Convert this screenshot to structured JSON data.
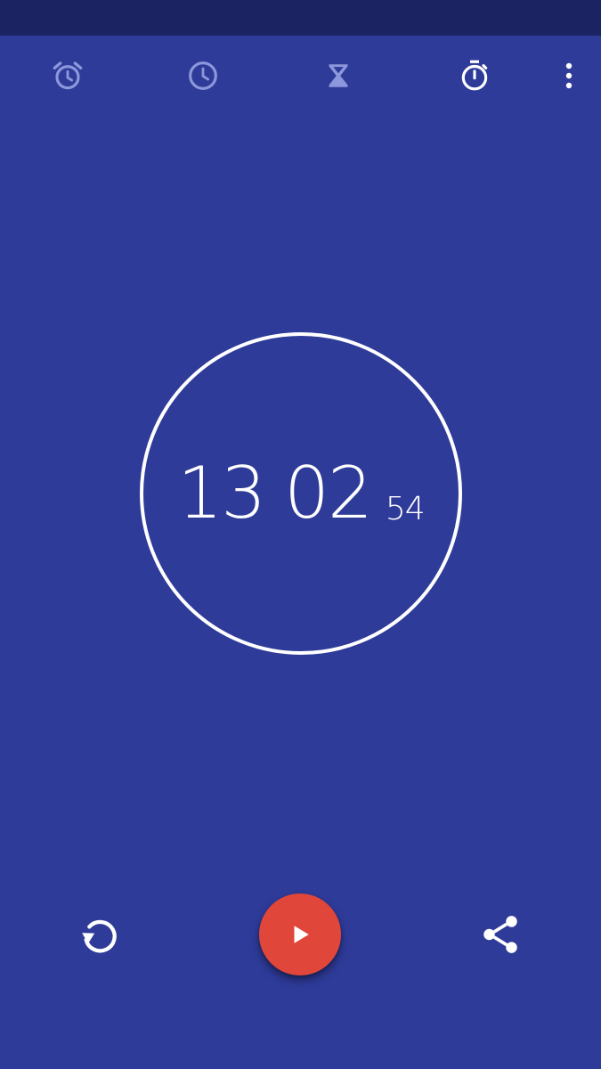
{
  "app": {
    "tabs": [
      {
        "id": "alarm",
        "icon": "alarm-icon",
        "active": false
      },
      {
        "id": "clock",
        "icon": "clock-icon",
        "active": false
      },
      {
        "id": "timer",
        "icon": "hourglass-icon",
        "active": false
      },
      {
        "id": "stopwatch",
        "icon": "stopwatch-icon",
        "active": true
      }
    ],
    "overflow_icon": "more-vert-icon"
  },
  "stopwatch": {
    "minutes": "13",
    "seconds": "02",
    "hundredths": "54",
    "running": false
  },
  "controls": {
    "reset_icon": "reset-icon",
    "start_icon": "play-icon",
    "share_icon": "share-icon"
  },
  "colors": {
    "background": "#2e3b99",
    "status_bar": "#1b2363",
    "fab": "#e1463a",
    "inactive_tab_icon": "#8d97db",
    "active_tab_icon": "#ffffff"
  }
}
